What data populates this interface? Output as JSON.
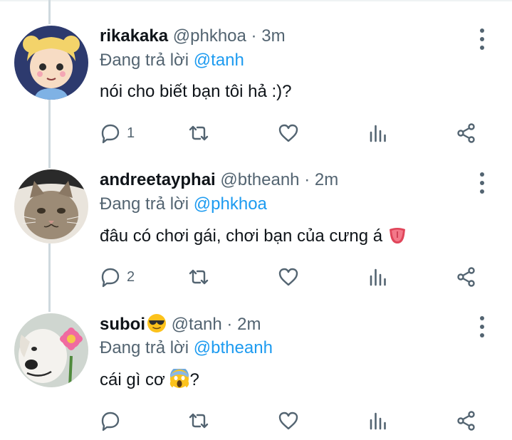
{
  "tweets": [
    {
      "name": "rikakaka",
      "name_emoji": "",
      "handle": "@phkhoa",
      "time": "3m",
      "reply_prefix": "Đang trả lời",
      "reply_to": "@tanh",
      "text": "nói cho biết bạn tôi hả :)?",
      "text_emoji": "",
      "text_suffix": "",
      "reply_count": "1",
      "avatar": "cartoon-girl-avatar"
    },
    {
      "name": "andreetayphai",
      "name_emoji": "",
      "handle": "@btheanh",
      "time": "2m",
      "reply_prefix": "Đang trả lời",
      "reply_to": "@phkhoa",
      "text": "đâu có chơi gái, chơi bạn của cưng á",
      "text_emoji": "tongue-emoji",
      "text_suffix": "",
      "reply_count": "2",
      "avatar": "cat-avatar"
    },
    {
      "name": "suboi",
      "name_emoji": "sunglasses-emoji",
      "handle": "@tanh",
      "time": "2m",
      "reply_prefix": "Đang trả lời",
      "reply_to": "@btheanh",
      "text": "cái gì cơ",
      "text_emoji": "screaming-face-emoji",
      "text_suffix": "?",
      "reply_count": "",
      "avatar": "dog-with-flower-avatar"
    }
  ],
  "separator": "·",
  "colors": {
    "link": "#1d9bf0",
    "secondary": "#536471",
    "primary": "#0f1419",
    "thread_line": "#cfd9de"
  }
}
